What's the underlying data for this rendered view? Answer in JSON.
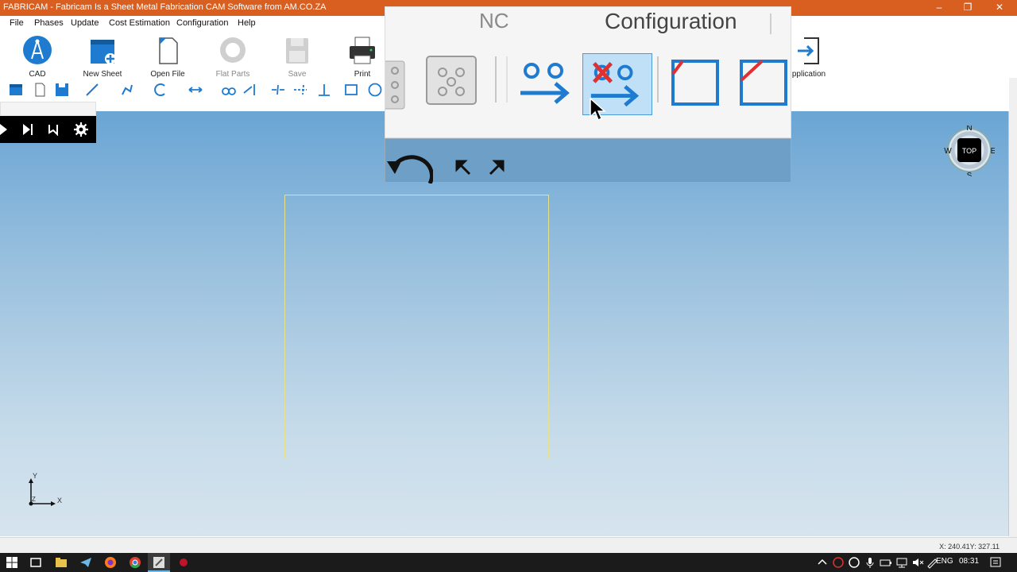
{
  "window": {
    "title": "FABRICAM - Fabricam Is a Sheet Metal Fabrication CAM Software from AM.CO.ZA",
    "controls": {
      "minimize": "–",
      "maximize": "❐",
      "close": "✕"
    }
  },
  "menu": [
    "File",
    "Phases",
    "Update",
    "Cost Estimation",
    "Configuration",
    "Help"
  ],
  "ribbon": {
    "cad": "CAD",
    "new_sheet": "New Sheet",
    "open_file": "Open File",
    "flat_parts": "Flat Parts",
    "save": "Save",
    "print": "Print",
    "application": "pplication"
  },
  "popup": {
    "title_left": "NC",
    "title_right": "Configuration"
  },
  "compass": {
    "n": "N",
    "s": "S",
    "e": "E",
    "w": "W",
    "center": "TOP"
  },
  "axis": {
    "x": "X",
    "y": "Y",
    "z": "Z"
  },
  "status": {
    "coords": "X: 240.41Y: 327.11"
  },
  "tray": {
    "lang": "ENG",
    "time": "08:31"
  },
  "colors": {
    "titlebar": "#d85f1f",
    "accent_blue": "#1e7bd0",
    "nc_red": "#e23030"
  }
}
